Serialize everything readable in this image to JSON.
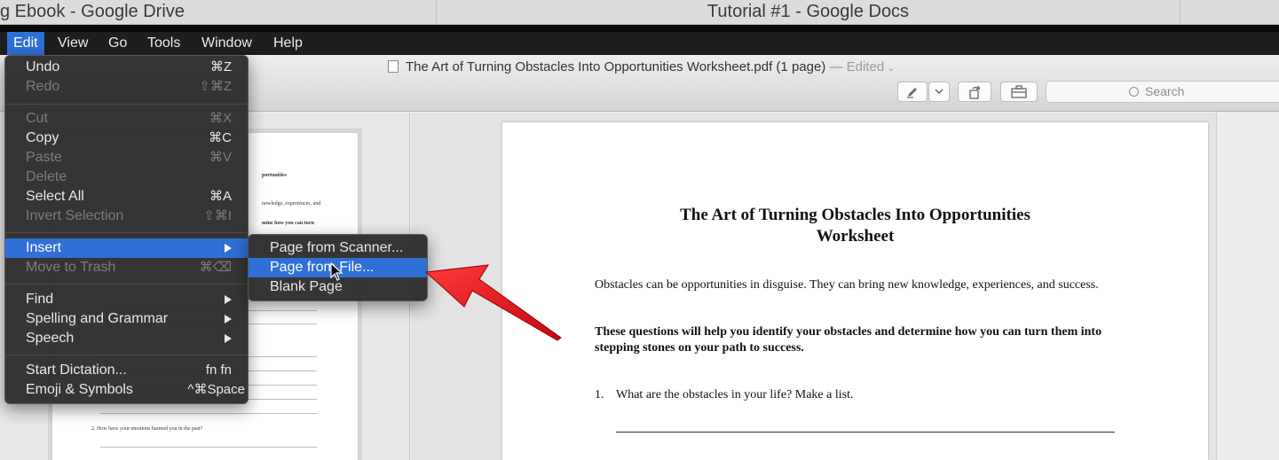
{
  "tabs": [
    {
      "label": "g Ebook - Google Drive"
    },
    {
      "label": "Tutorial #1 - Google Docs"
    }
  ],
  "menubar": {
    "items": [
      "Edit",
      "View",
      "Go",
      "Tools",
      "Window",
      "Help"
    ]
  },
  "document": {
    "filename": "The Art of Turning Obstacles Into Opportunities Worksheet.pdf (1 page)",
    "separator": "—",
    "status": "Edited",
    "search_placeholder": "Search"
  },
  "edit_menu": {
    "items": [
      {
        "label": "Undo",
        "shortcut": "⌘Z",
        "enabled": true
      },
      {
        "label": "Redo",
        "shortcut": "⇧⌘Z",
        "enabled": false
      },
      {
        "label": "Cut",
        "shortcut": "⌘X",
        "enabled": false
      },
      {
        "label": "Copy",
        "shortcut": "⌘C",
        "enabled": true
      },
      {
        "label": "Paste",
        "shortcut": "⌘V",
        "enabled": false
      },
      {
        "label": "Delete",
        "shortcut": "",
        "enabled": false
      },
      {
        "label": "Select All",
        "shortcut": "⌘A",
        "enabled": true
      },
      {
        "label": "Invert Selection",
        "shortcut": "⇧⌘I",
        "enabled": false
      },
      {
        "label": "Insert",
        "shortcut": "",
        "enabled": true,
        "submenu": true,
        "highlighted": true
      },
      {
        "label": "Move to Trash",
        "shortcut": "⌘⌫",
        "enabled": false
      },
      {
        "label": "Find",
        "enabled": true,
        "submenu": true
      },
      {
        "label": "Spelling and Grammar",
        "enabled": true,
        "submenu": true
      },
      {
        "label": "Speech",
        "enabled": true,
        "submenu": true
      },
      {
        "label": "Start Dictation...",
        "shortcut": "fn fn",
        "enabled": true
      },
      {
        "label": "Emoji & Symbols",
        "shortcut": "^⌘Space",
        "enabled": true
      }
    ]
  },
  "insert_submenu": {
    "items": [
      {
        "label": "Page from Scanner...",
        "highlighted": false
      },
      {
        "label": "Page from File...",
        "highlighted": true
      },
      {
        "label": "Blank Page",
        "highlighted": false
      }
    ]
  },
  "thumbnail": {
    "title_fragment": "portunities",
    "line1_fragment": "nowledge, experiences, and",
    "line2_fragment": "mine how you can turn",
    "question": "2.   How have your emotions harmed you in the past?"
  },
  "page": {
    "title_line1": "The Art of Turning Obstacles Into Opportunities",
    "title_line2": "Worksheet",
    "para1": "Obstacles can be opportunities in disguise. They can bring new knowledge, experiences, and success.",
    "para2": "These questions will help you identify your obstacles and determine how you can turn them into stepping stones on your path to success.",
    "q1_num": "1.",
    "q1_text": "What are the obstacles in your life? Make a list."
  },
  "colors": {
    "highlight": "#2f6fd6",
    "annotation_arrow": "#e0141c",
    "menu_bg": "#2e2e2e"
  }
}
